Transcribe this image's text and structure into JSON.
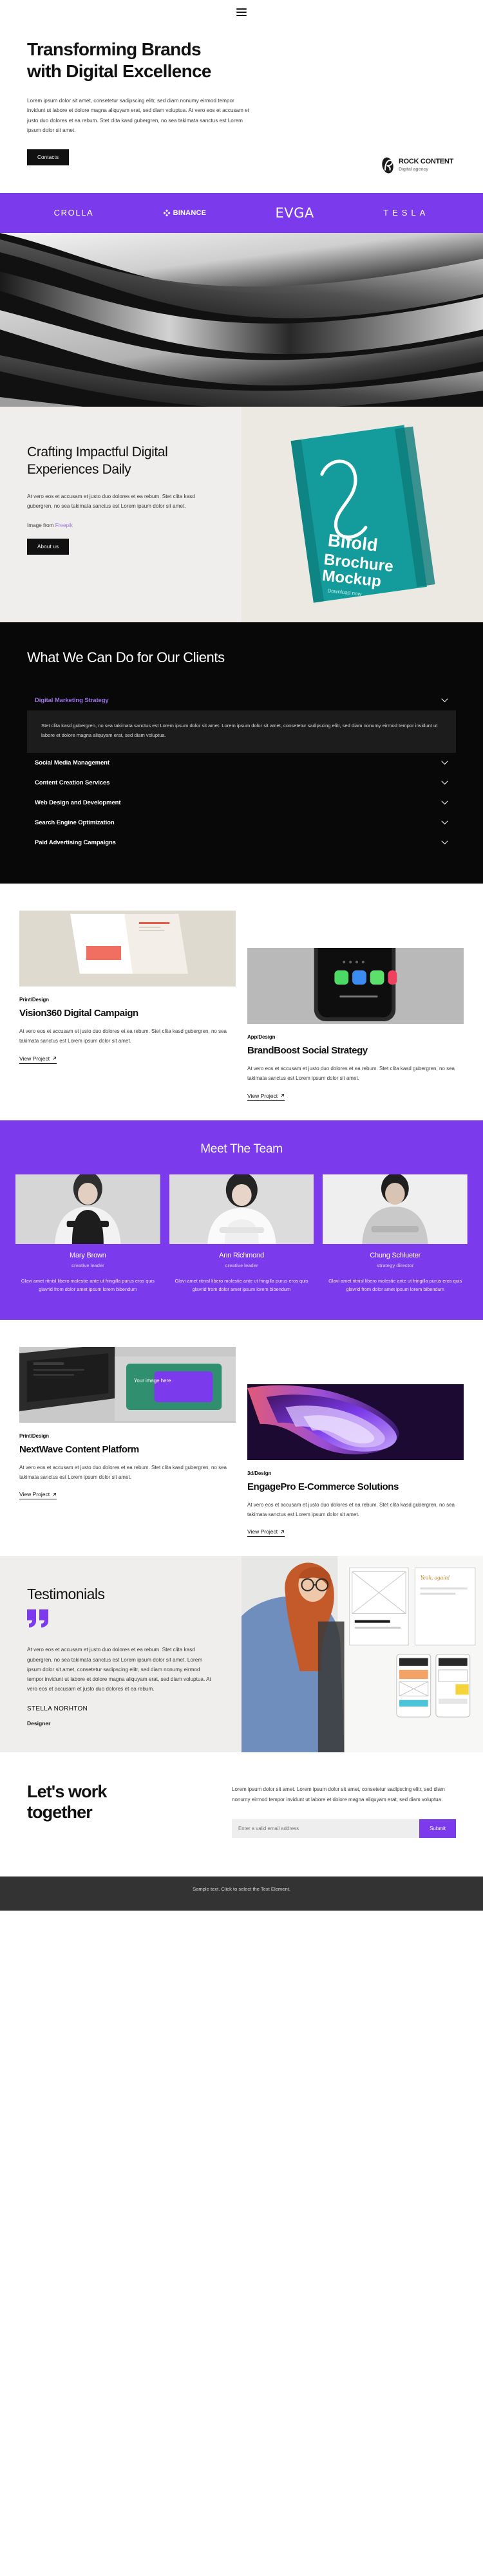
{
  "header": {
    "menu_icon": "hamburger-icon"
  },
  "hero": {
    "title_line1": "Transforming Brands",
    "title_line2": "with Digital Excellence",
    "paragraph": "Lorem ipsum dolor sit amet, consetetur sadipscing elitr, sed diam nonumy eirmod tempor invidunt ut labore et dolore magna aliquyam erat, sed diam voluptua. At vero eos et accusam et justo duo dolores et ea rebum. Stet clita kasd gubergren, no sea takimata sanctus est Lorem ipsum dolor sit amet.",
    "cta_label": "Contacts",
    "brand_name": "ROCK CONTENT",
    "brand_sub": "Digital agency"
  },
  "logos": {
    "items": [
      {
        "name": "CROLLA"
      },
      {
        "name": "BINANCE"
      },
      {
        "name": "EVGA"
      },
      {
        "name": "TESLA"
      }
    ],
    "background": "#7C3AED"
  },
  "crafting": {
    "title": "Crafting Impactful Digital Experiences Daily",
    "paragraph": "At vero eos et accusam et justo duo dolores et ea rebum. Stet clita kasd gubergren, no sea takimata sanctus est Lorem ipsum dolor sit amet.",
    "credit_prefix": "Image from ",
    "credit_link": "Freepik",
    "button_label": "About us",
    "mockup_label_top": "Bifold",
    "mockup_label_bottom": "Brochure Mockup",
    "mockup_sub": "Download now"
  },
  "services": {
    "title": "What We Can Do for Our Clients",
    "items": [
      {
        "label": "Digital Marketing Strategy",
        "open": true,
        "body": "Stet clita kasd gubergren, no sea takimata sanctus est Lorem ipsum dolor sit amet. Lorem ipsum dolor sit amet, consetetur sadipscing elitr, sed diam nonumy eirmod tempor invidunt ut labore et dolore magna aliquyam erat, sed diam voluptua."
      },
      {
        "label": "Social Media Management",
        "open": false,
        "body": ""
      },
      {
        "label": "Content Creation Services",
        "open": false,
        "body": ""
      },
      {
        "label": "Web Design and Development",
        "open": false,
        "body": ""
      },
      {
        "label": "Search Engine Optimization",
        "open": false,
        "body": ""
      },
      {
        "label": "Paid Advertising Campaigns",
        "open": false,
        "body": ""
      }
    ],
    "accent": "#9b72e8"
  },
  "portfolio_top": {
    "left": {
      "category": "Print/Design",
      "title": "Vision360 Digital Campaign",
      "description": "At vero eos et accusam et justo duo dolores et ea rebum. Stet clita kasd gubergren, no sea takimata sanctus est Lorem ipsum dolor sit amet.",
      "link_label": "View Project"
    },
    "right": {
      "category": "App/Design",
      "title": "BrandBoost Social Strategy",
      "description": "At vero eos et accusam et justo duo dolores et ea rebum. Stet clita kasd gubergren, no sea takimata sanctus est Lorem ipsum dolor sit amet.",
      "link_label": "View Project"
    }
  },
  "team": {
    "title": "Meet The Team",
    "members": [
      {
        "name": "Mary Brown",
        "role": "creative leader",
        "bio": "Glavi amet ritnisl libero molestie ante ut fringilla purus eros quis glavrid from dolor amet ipsum lorem bibendum"
      },
      {
        "name": "Ann Richmond",
        "role": "creative leader",
        "bio": "Glavi amet ritnisl libero molestie ante ut fringilla purus eros quis glavrid from dolor amet ipsum lorem bibendum"
      },
      {
        "name": "Chung Schlueter",
        "role": "strategy director",
        "bio": "Glavi amet ritnisl libero molestie ante ut fringilla purus eros quis glavrid from dolor amet ipsum lorem bibendum"
      }
    ]
  },
  "portfolio_bottom": {
    "left": {
      "category": "Print/Design",
      "title": "NextWave Content Platform",
      "description": "At vero eos et accusam et justo duo dolores et ea rebum. Stet clita kasd gubergren, no sea takimata sanctus est Lorem ipsum dolor sit amet.",
      "link_label": "View Project"
    },
    "right": {
      "category": "3d/Design",
      "title": "EngagePro E-Commerce Solutions",
      "description": "At vero eos et accusam et justo duo dolores et ea rebum. Stet clita kasd gubergren, no sea takimata sanctus est Lorem ipsum dolor sit amet.",
      "link_label": "View Project"
    }
  },
  "testimonials": {
    "title": "Testimonials",
    "quote": "At vero eos et accusam et justo duo dolores et ea rebum. Stet clita kasd gubergren, no sea takimata sanctus est Lorem ipsum dolor sit amet. Lorem ipsum dolor sit amet, consetetur sadipscing elitr, sed diam nonumy eirmod tempor invidunt ut labore et dolore magna aliquyam erat, sed diam voluptua. At vero eos et accusam et justo duo dolores et ea rebum.",
    "author": "STELLA NORHTON",
    "author_role": "Designer"
  },
  "cta": {
    "title_line1": "Let's work",
    "title_line2": "together",
    "paragraph": "Lorem ipsum dolor sit amet. Lorem ipsum dolor sit amet, consetetur sadipscing elitr, sed diam nonumy eirmod tempor invidunt ut labore et dolore magna aliquyam erat, sed diam voluptua.",
    "email_placeholder": "Enter a valid email address",
    "email_value": "",
    "submit_label": "Submit",
    "accent": "#7C3AED"
  },
  "bottom_bar": {
    "text": "Sample text. Click to select the Text Element."
  }
}
